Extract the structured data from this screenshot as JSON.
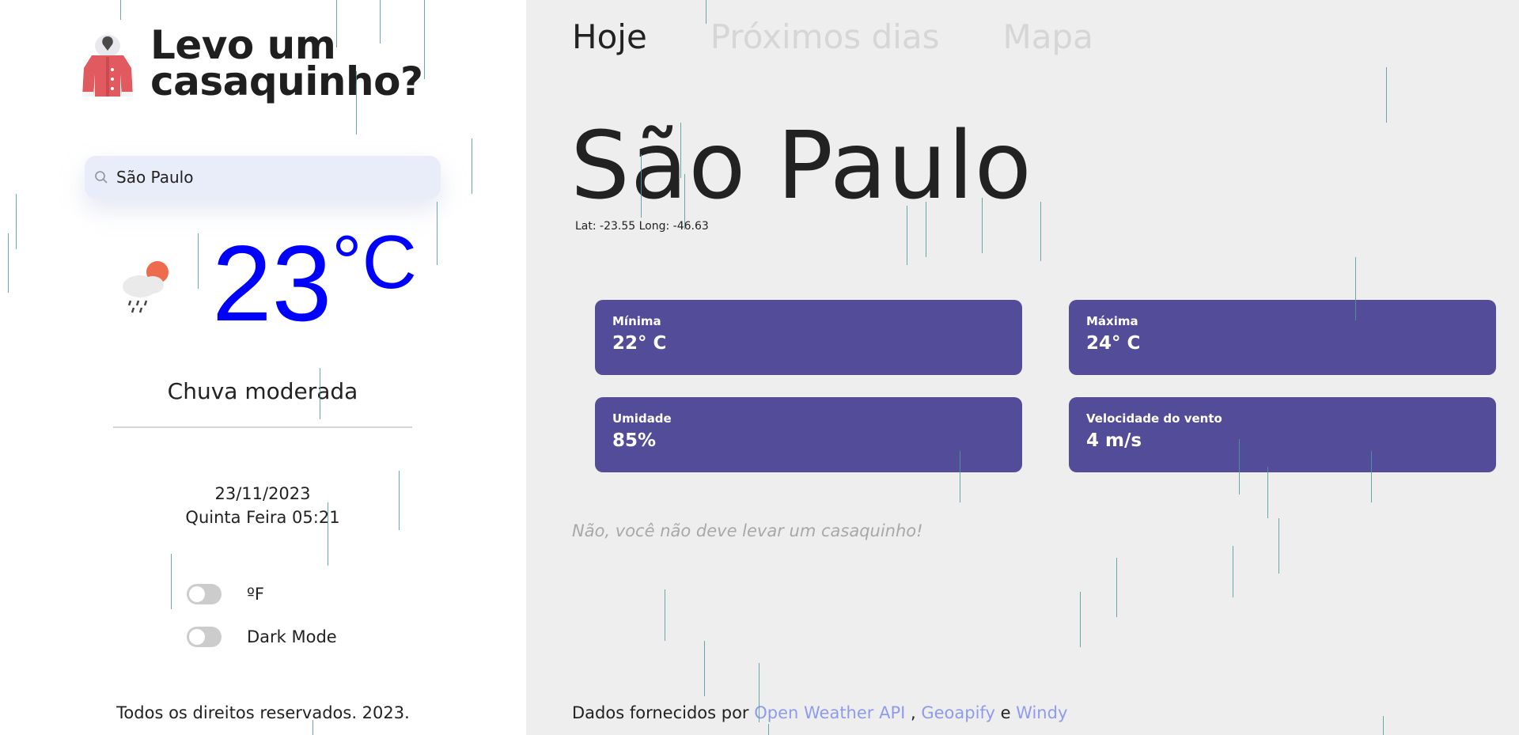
{
  "brand": {
    "title_line1": "Levo um",
    "title_line2": "casaquinho?",
    "icon": "coat-icon"
  },
  "search": {
    "value": "São Paulo",
    "icon": "search-icon"
  },
  "current": {
    "weather_icon": "cloud-rain-sun-icon",
    "temperature": "23",
    "unit": "°C",
    "description": "Chuva moderada",
    "date": "23/11/2023",
    "day_time": "Quinta Feira 05:21"
  },
  "toggles": {
    "fahrenheit_label": "ºF",
    "dark_mode_label": "Dark Mode"
  },
  "footer_left": "Todos os direitos reservados. 2023.",
  "tabs": [
    {
      "label": "Hoje",
      "active": true
    },
    {
      "label": "Próximos dias",
      "active": false
    },
    {
      "label": "Mapa",
      "active": false
    }
  ],
  "city": {
    "name": "São Paulo",
    "coords": "Lat: -23.55 Long: -46.63"
  },
  "cards": {
    "min": {
      "label": "Mínima",
      "value": "22° C"
    },
    "max": {
      "label": "Máxima",
      "value": "24° C"
    },
    "humidity": {
      "label": "Umidade",
      "value": "85%"
    },
    "wind": {
      "label": "Velocidade do vento",
      "value": "4 m/s"
    }
  },
  "advice": "Não, você não deve levar um casaquinho!",
  "credits": {
    "prefix": "Dados fornecidos por ",
    "link1": "Open Weather API",
    "sep1": " , ",
    "link2": "Geoapify",
    "sep2": " e ",
    "link3": "Windy"
  },
  "colors": {
    "temperature": "#0000ff",
    "card_bg": "#534c99",
    "link": "#8f9bea",
    "right_bg": "#eeeeee"
  }
}
